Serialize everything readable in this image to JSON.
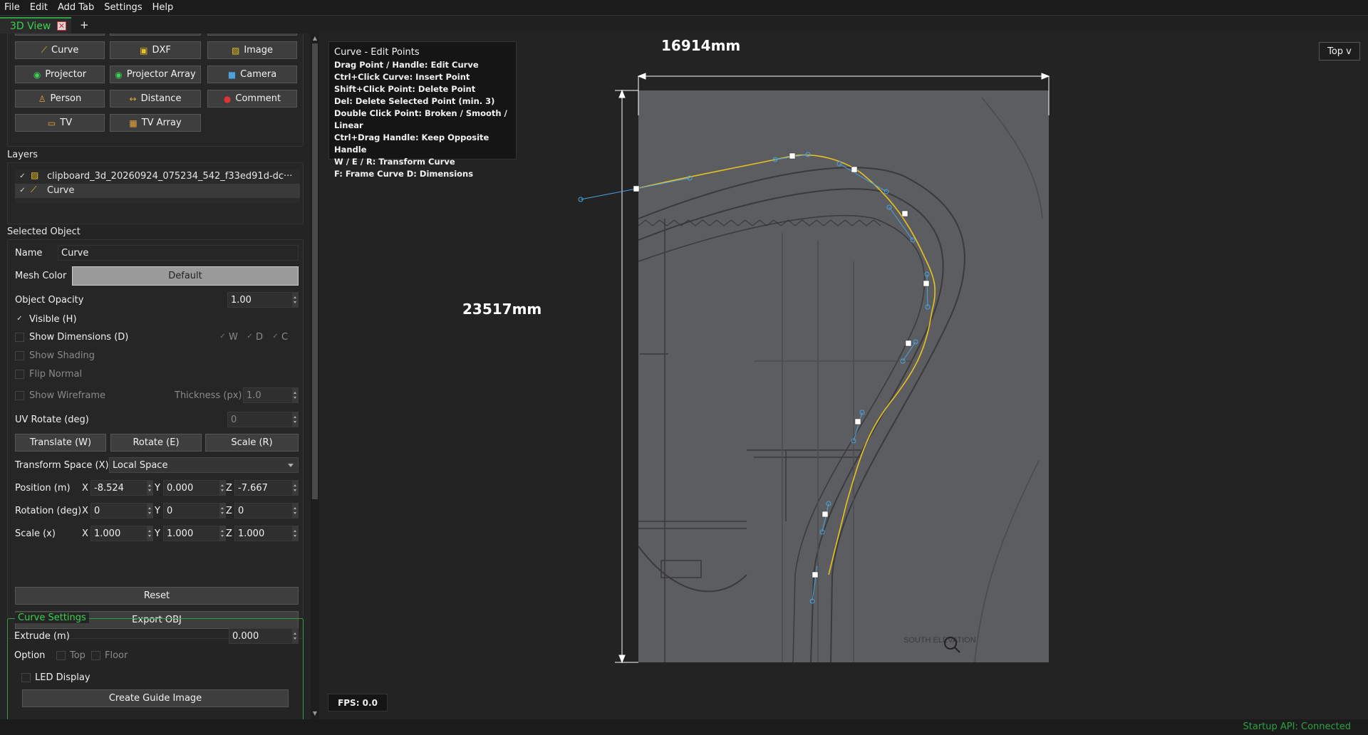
{
  "menu": [
    "File",
    "Edit",
    "Add Tab",
    "Settings",
    "Help"
  ],
  "tab": {
    "label": "3D View",
    "close": "✕",
    "add": "+"
  },
  "toolbar": {
    "row1": [
      {
        "label": "Curve",
        "icon": "curve-icon"
      },
      {
        "label": "DXF",
        "icon": "dxf-icon"
      },
      {
        "label": "Image",
        "icon": "image-icon"
      }
    ],
    "row2": [
      {
        "label": "Projector",
        "icon": "projector-icon"
      },
      {
        "label": "Projector Array",
        "icon": "projector-array-icon"
      },
      {
        "label": "Camera",
        "icon": "camera-icon"
      }
    ],
    "row3": [
      {
        "label": "Person",
        "icon": "person-icon"
      },
      {
        "label": "Distance",
        "icon": "distance-icon"
      },
      {
        "label": "Comment",
        "icon": "comment-icon"
      }
    ],
    "row4": [
      {
        "label": "TV",
        "icon": "tv-icon"
      },
      {
        "label": "TV Array",
        "icon": "tv-array-icon"
      }
    ]
  },
  "layers": {
    "title": "Layers",
    "items": [
      {
        "label": "clipboard_3d_20260924_075234_542_f33ed91d-dc···",
        "checked": true
      },
      {
        "label": "Curve",
        "checked": true
      }
    ]
  },
  "selected": {
    "title": "Selected Object",
    "name_label": "Name",
    "name_value": "Curve",
    "mesh_color_label": "Mesh Color",
    "mesh_color_value": "Default",
    "opacity_label": "Object Opacity",
    "opacity_value": "1.00",
    "visible_label": "Visible (H)",
    "show_dimensions_label": "Show Dimensions (D)",
    "dim_w": "W",
    "dim_d": "D",
    "dim_c": "C",
    "show_shading_label": "Show Shading",
    "flip_normal_label": "Flip Normal",
    "show_wireframe_label": "Show Wireframe",
    "thickness_label": "Thickness (px)",
    "thickness_value": "1.0",
    "uv_rotate_label": "UV Rotate (deg)",
    "uv_rotate_value": "0",
    "translate_label": "Translate (W)",
    "rotate_label": "Rotate (E)",
    "scale_label": "Scale (R)",
    "transform_space_label": "Transform Space (X)",
    "transform_space_value": "Local Space",
    "position_label": "Position (m)",
    "position": {
      "x": "-8.524",
      "y": "0.000",
      "z": "-7.667"
    },
    "rotation_label": "Rotation (deg)",
    "rotation": {
      "x": "0",
      "y": "0",
      "z": "0"
    },
    "scale_label2": "Scale (x)",
    "scale": {
      "x": "1.000",
      "y": "1.000",
      "z": "1.000"
    },
    "axis_x": "X",
    "axis_y": "Y",
    "axis_z": "Z",
    "reset_label": "Reset",
    "export_label": "Export OBJ"
  },
  "curve_settings": {
    "title": "Curve Settings",
    "extrude_label": "Extrude (m)",
    "extrude_value": "0.000",
    "option_label": "Option",
    "top_label": "Top",
    "floor_label": "Floor",
    "led_label": "LED Display",
    "create_guide_label": "Create Guide Image"
  },
  "help": {
    "title": "Curve - Edit Points",
    "lines": [
      "Drag Point / Handle: Edit Curve",
      "Ctrl+Click Curve: Insert Point",
      "Shift+Click Point: Delete Point",
      "Del: Delete Selected Point (min. 3)",
      "Double Click Point: Broken / Smooth / Linear",
      "Ctrl+Drag Handle: Keep Opposite Handle",
      "W / E / R: Transform Curve",
      "F: Frame Curve   D: Dimensions"
    ]
  },
  "view_mode": "Top v",
  "dimensions": {
    "width": "16914mm",
    "height": "23517mm"
  },
  "fps": "FPS: 0.0",
  "image_text": {
    "title": "SOUTH ELEVATION"
  },
  "status": "Startup API: Connected",
  "colors": {
    "accent": "#2ea043",
    "curve": "#e8c21e",
    "handle": "#4aa3df"
  }
}
